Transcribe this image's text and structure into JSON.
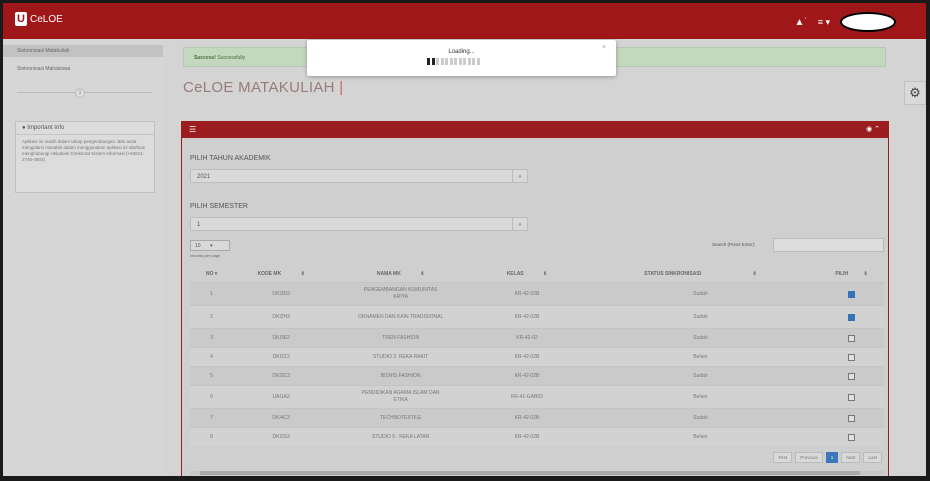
{
  "app": {
    "name": "CeLOE"
  },
  "header": {
    "bell_icon": "bell-icon",
    "menu_icon": "menu-icon",
    "menu_caret": "≡ ▾"
  },
  "sidebar": {
    "items": [
      {
        "label": "Sinkronisasi Matakuliah",
        "active": true
      },
      {
        "label": "Sinkronisasi Mahasiswa",
        "active": false
      }
    ],
    "step_number": "1",
    "info": {
      "title": "Important Info",
      "text": "Aplikasi ini masih dalam tahap pengembangan. Bila anda mengalami masalah dalam menggunakan aplikasi ini silahkan menghubungi Helpdesk Direktorat Sistem Informasi (+62821-2745-4803)"
    }
  },
  "alert": {
    "strong": "Success!",
    "text": "Successfully"
  },
  "page": {
    "title": "CeLOE MATAKULIAH",
    "cursor": "|"
  },
  "filters": {
    "year_label": "PILIH TAHUN AKADEMIK",
    "year_value": "2021",
    "semester_label": "PILIH SEMESTER",
    "semester_value": "1"
  },
  "table_controls": {
    "per_page": "10",
    "per_page_label": "records per page",
    "search_label": "Search (Press Enter):"
  },
  "table": {
    "headers": [
      "NO",
      "KODE MK",
      "NAMA MK",
      "KELAS",
      "STATUS SINKRONISASI",
      "PILIH"
    ],
    "rows": [
      {
        "no": "1",
        "kode": "DKI3D3",
        "nama": "PENGEMBANGAN KOMUNITAS KRIYA",
        "kelas": "KR-42-02B",
        "status": "Sudah",
        "checked": true
      },
      {
        "no": "2",
        "kode": "DKI2H3",
        "nama": "ORNAMEN DAN KAIN TRADISIONAL",
        "kelas": "KR-42-02B",
        "status": "Sudah",
        "checked": true
      },
      {
        "no": "3",
        "kode": "DKI3E2",
        "nama": "TREN FASHION",
        "kelas": "KR-42-02",
        "status": "Sudah",
        "checked": false
      },
      {
        "no": "4",
        "kode": "DKI2Z3",
        "nama": "STUDIO 2: REKA RAKIT",
        "kelas": "KR-42-02B",
        "status": "Belum",
        "checked": false
      },
      {
        "no": "5",
        "kode": "DKI3C3",
        "nama": "BISNIS FASHION",
        "kelas": "KR-42-02B",
        "status": "Sudah",
        "checked": false
      },
      {
        "no": "6",
        "kode": "UAI1A2",
        "nama": "PENDIDIKAN AGAMA ISLAM DAN ETIKA",
        "kelas": "KR-41-GAB03",
        "status": "Belum",
        "checked": false
      },
      {
        "no": "7",
        "kode": "DKI4C3",
        "nama": "TECHNOTEXTILE",
        "kelas": "KR-42-02B",
        "status": "Sudah",
        "checked": false
      },
      {
        "no": "8",
        "kode": "DKI3S3",
        "nama": "STUDIO 5 : REKA LATAR",
        "kelas": "KR-42-02B",
        "status": "Belum",
        "checked": false
      }
    ]
  },
  "pagination": {
    "first": "First",
    "previous": "Previous",
    "current": "1",
    "next": "Next",
    "last": "Last"
  },
  "modal": {
    "title": "Loading...",
    "close": "×",
    "progress": 0.167
  }
}
